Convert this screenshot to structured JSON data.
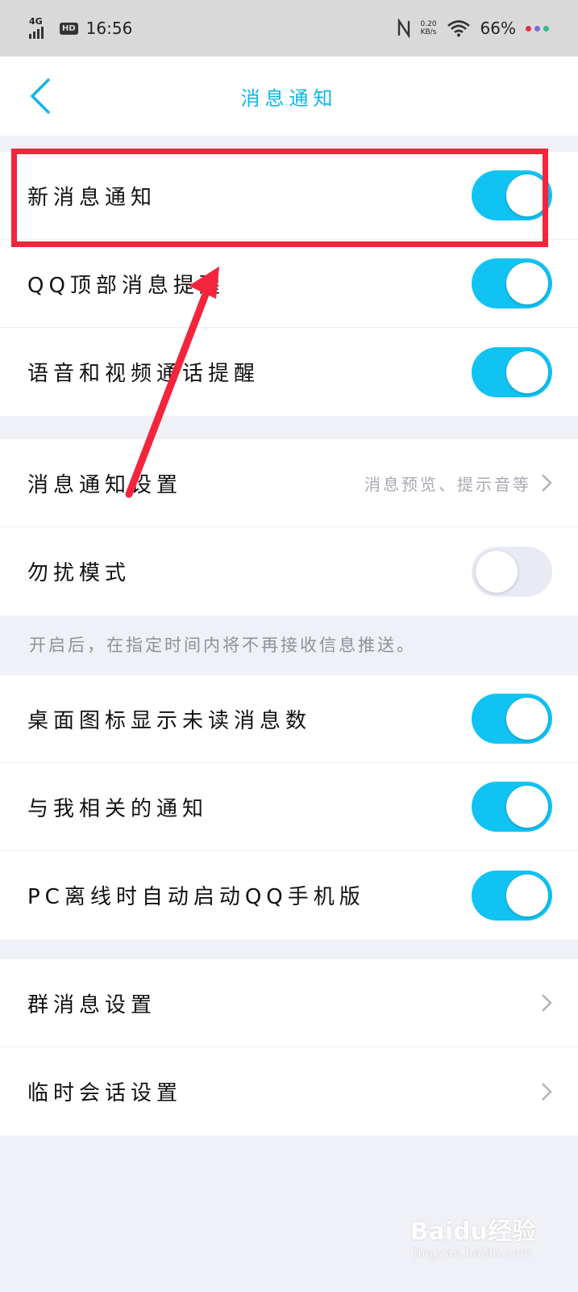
{
  "status_bar": {
    "network": "4G",
    "hd": "HD",
    "time": "16:56",
    "speed_value": "0.20",
    "speed_unit": "KB/s",
    "battery": "66%"
  },
  "header": {
    "title": "消息通知"
  },
  "sections": [
    {
      "rows": [
        {
          "label": "新消息通知",
          "toggle": true
        },
        {
          "label": "QQ顶部消息提醒",
          "toggle": true
        },
        {
          "label": "语音和视频通话提醒",
          "toggle": true
        }
      ]
    },
    {
      "rows": [
        {
          "label": "消息通知设置",
          "hint": "消息预览、提示音等"
        },
        {
          "label": "勿扰模式",
          "toggle": false
        }
      ]
    },
    {
      "rows": [
        {
          "label": "桌面图标显示未读消息数",
          "toggle": true
        },
        {
          "label": "与我相关的通知",
          "toggle": true
        },
        {
          "label": "PC离线时自动启动QQ手机版",
          "toggle": true
        }
      ]
    },
    {
      "rows": [
        {
          "label": "群消息设置"
        },
        {
          "label": "临时会话设置"
        }
      ]
    }
  ],
  "dnd_note": "开启后，在指定时间内将不再接收信息推送。",
  "watermark": {
    "brand": "Baidu经验",
    "url": "jingyan.baidu.com"
  },
  "colors": {
    "accent": "#10c3f3",
    "title": "#0fb5e5",
    "annotation": "#f4243d"
  }
}
